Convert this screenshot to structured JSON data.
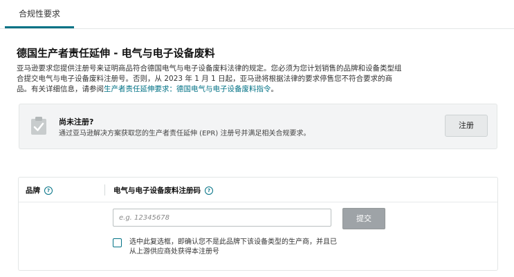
{
  "tabs": [
    {
      "label": "合规性要求",
      "active": true
    }
  ],
  "page": {
    "title": "德国生产者责任延伸 - 电气与电子设备废料",
    "intro_text": "亚马逊要求您提供注册号来证明商品符合德国电气与电子设备废料法律的规定。您必须为您计划销售的品牌和设备类型组合提交电气与电子设备废料注册号。否则，从 2023 年 1 月 1 日起，亚马逊将根据法律的要求停售您不符合要求的商品。有关详细信息，请参阅",
    "intro_link": "生产者责任延伸要求：德国电气与电子设备废料指令",
    "intro_end": "。"
  },
  "notice": {
    "icon": "clipboard-check-icon",
    "title": "尚未注册?",
    "description": "通过亚马逊解决方案获取您的生产者责任延伸 (EPR) 注册号并满足相关合规要求。",
    "button_label": "注册"
  },
  "form": {
    "brand_header": "品牌",
    "epr_header": "电气与电子设备废料注册码",
    "help_glyph": "?",
    "input_value": "",
    "input_placeholder": "e.g. 12345678",
    "submit_label": "提交",
    "checkbox_checked": false,
    "checkbox_label": "选中此复选框，即确认您不是此品牌下该设备类型的生产商，并且已从上游供应商处获得本注册号"
  },
  "colors": {
    "accent": "#007185",
    "submit_disabled": "#9ea3a7",
    "notice_bg": "#f3f4f5"
  }
}
